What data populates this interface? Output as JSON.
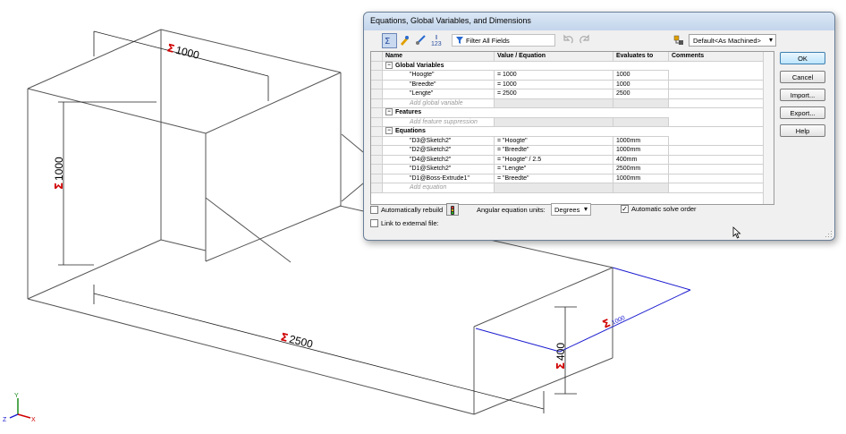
{
  "viewport": {
    "dimensions": [
      {
        "symbol": "Σ",
        "value": "1000"
      },
      {
        "symbol": "Σ",
        "value": "1000"
      },
      {
        "symbol": "Σ",
        "value": "2500"
      },
      {
        "symbol": "Σ",
        "value": "400"
      },
      {
        "symbol": "Σ",
        "value": "1000"
      }
    ],
    "triad": {
      "x": "X",
      "y": "Y",
      "z": "Z"
    }
  },
  "dialog": {
    "title": "Equations, Global Variables, and Dimensions",
    "toolbar": {
      "filter_placeholder": "Filter All Fields",
      "configuration": "Default<As Machined>"
    },
    "columns": [
      "Name",
      "Value / Equation",
      "Evaluates to",
      "Comments"
    ],
    "sections": [
      {
        "label": "Global Variables",
        "rows": [
          {
            "name": "\"Hoogte\"",
            "value": "= 1000",
            "evaluates": "1000"
          },
          {
            "name": "\"Breedte\"",
            "value": "= 1000",
            "evaluates": "1000"
          },
          {
            "name": "\"Lengte\"",
            "value": "= 2500",
            "evaluates": "2500"
          }
        ],
        "add_label": "Add global variable"
      },
      {
        "label": "Features",
        "rows": [],
        "add_label": "Add feature suppression"
      },
      {
        "label": "Equations",
        "rows": [
          {
            "name": "\"D3@Sketch2\"",
            "value": "= \"Hoogte\"",
            "evaluates": "1000mm"
          },
          {
            "name": "\"D2@Sketch2\"",
            "value": "= \"Breedte\"",
            "evaluates": "1000mm"
          },
          {
            "name": "\"D4@Sketch2\"",
            "value": "= \"Hoogte\" / 2.5",
            "evaluates": "400mm"
          },
          {
            "name": "\"D1@Sketch2\"",
            "value": "= \"Lengte\"",
            "evaluates": "2500mm"
          },
          {
            "name": "\"D1@Boss-Extrude1\"",
            "value": "= \"Breedte\"",
            "evaluates": "1000mm"
          }
        ],
        "add_label": "Add equation"
      }
    ],
    "options": {
      "auto_rebuild": "Automatically rebuild",
      "auto_rebuild_checked": false,
      "angular_units_label": "Angular equation units:",
      "angular_units": "Degrees",
      "auto_solve": "Automatic solve order",
      "auto_solve_checked": true,
      "link_external": "Link to external file:",
      "link_external_checked": false
    },
    "buttons": {
      "ok": "OK",
      "cancel": "Cancel",
      "import": "Import...",
      "export": "Export...",
      "help": "Help"
    }
  }
}
